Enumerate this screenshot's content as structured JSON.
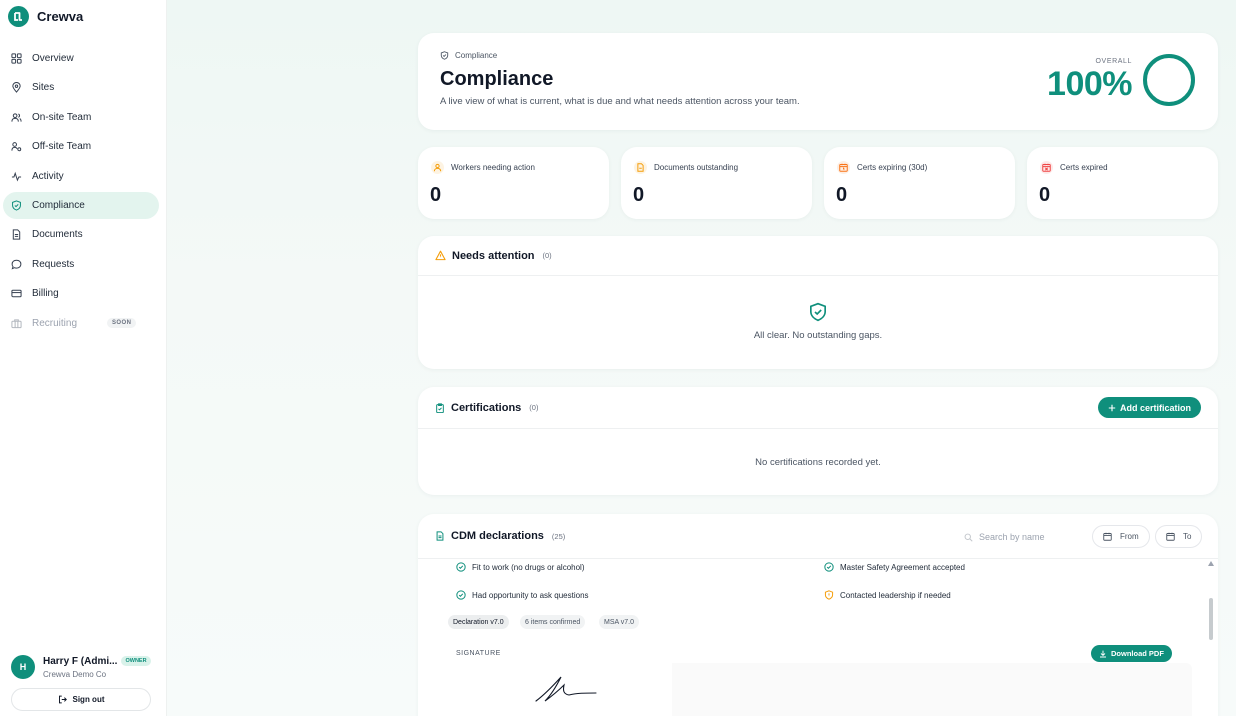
{
  "app": {
    "name": "Crewva"
  },
  "sidebar": {
    "items": [
      {
        "label": "Overview",
        "icon": "grid-icon"
      },
      {
        "label": "Sites",
        "icon": "map-pin-icon"
      },
      {
        "label": "On-site Team",
        "icon": "users-icon"
      },
      {
        "label": "Off-site Team",
        "icon": "user-remote-icon"
      },
      {
        "label": "Activity",
        "icon": "activity-icon"
      },
      {
        "label": "Compliance",
        "icon": "shield-check-icon",
        "active": true
      },
      {
        "label": "Documents",
        "icon": "document-icon"
      },
      {
        "label": "Requests",
        "icon": "chat-icon"
      },
      {
        "label": "Billing",
        "icon": "credit-card-icon"
      },
      {
        "label": "Recruiting",
        "icon": "briefcase-icon",
        "disabled": true,
        "badge": "SOON"
      }
    ],
    "user": {
      "initial": "H",
      "name": "Harry F (Admi...",
      "role": "OWNER",
      "org": "Crewva Demo Co"
    },
    "signout_label": "Sign out"
  },
  "header": {
    "breadcrumb": "Compliance",
    "title": "Compliance",
    "subtitle": "A live view of what is current, what is due and what needs attention across your team.",
    "overall_label": "OVERALL",
    "overall_value": "100%",
    "overall_fraction": 1.0
  },
  "stats": [
    {
      "label": "Workers needing action",
      "value": "0",
      "icon": "user-alert-icon",
      "color": "#f59e0b"
    },
    {
      "label": "Documents outstanding",
      "value": "0",
      "icon": "document-pending-icon",
      "color": "#f59e0b"
    },
    {
      "label": "Certs expiring (30d)",
      "value": "0",
      "icon": "calendar-clock-icon",
      "color": "#f97316"
    },
    {
      "label": "Certs expired",
      "value": "0",
      "icon": "calendar-x-icon",
      "color": "#ef4444"
    }
  ],
  "needs_attention": {
    "title": "Needs attention",
    "count": "(0)",
    "empty_message": "All clear. No outstanding gaps."
  },
  "certifications": {
    "title": "Certifications",
    "count": "(0)",
    "add_label": "Add certification",
    "empty_message": "No certifications recorded yet."
  },
  "cdm": {
    "title": "CDM declarations",
    "count": "(25)",
    "search_placeholder": "Search by name",
    "from_label": "From",
    "to_label": "To",
    "checks": [
      {
        "label": "Fit to work (no drugs or alcohol)",
        "status": "ok"
      },
      {
        "label": "Master Safety Agreement accepted",
        "status": "ok"
      },
      {
        "label": "Had opportunity to ask questions",
        "status": "ok"
      },
      {
        "label": "Contacted leadership if needed",
        "status": "warn"
      }
    ],
    "tags": [
      "Declaration v7.0",
      "6 items confirmed",
      "MSA v7.0"
    ],
    "signature_label": "SIGNATURE",
    "download_label": "Download PDF"
  },
  "colors": {
    "accent": "#0f8f7c",
    "warn": "#f59e0b",
    "danger": "#ef4444"
  }
}
